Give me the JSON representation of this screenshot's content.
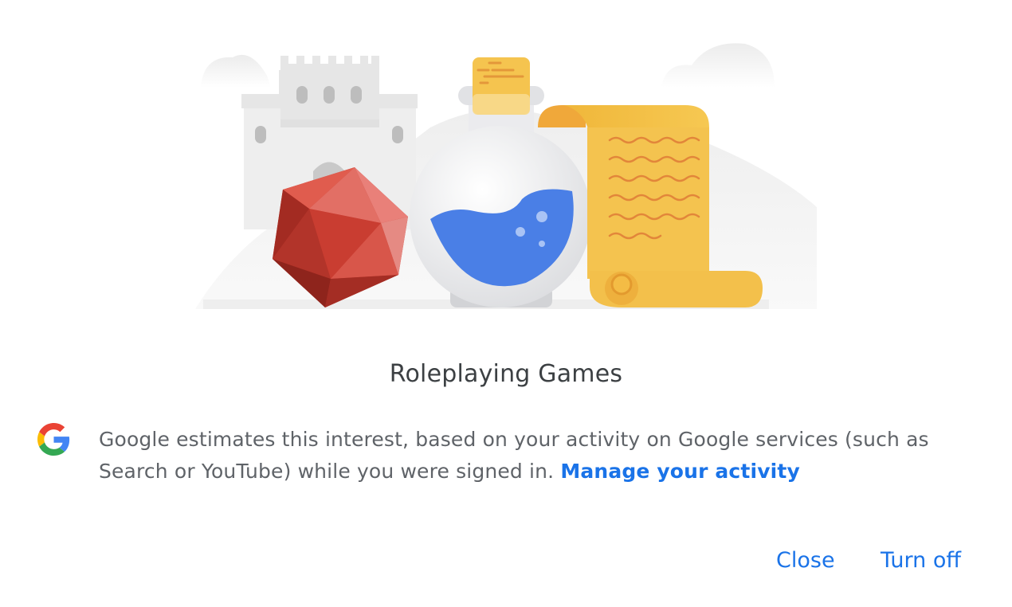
{
  "dialog": {
    "title": "Roleplaying Games",
    "description": "Google estimates this interest, based on your activity on Google services (such as Search or YouTube) while you were signed in.",
    "manage_link": "Manage your activity",
    "close_label": "Close",
    "turn_off_label": "Turn off"
  },
  "illustration": {
    "items": [
      "castle",
      "d20-dice",
      "potion-flask",
      "scroll"
    ]
  },
  "colors": {
    "accent": "#1a73e8",
    "title_text": "#3c4043",
    "body_text": "#5f6368",
    "dice_red": "#d94a3d",
    "potion_blue": "#4a7fe6",
    "scroll_yellow": "#f3c451"
  },
  "icons": {
    "brand": "google-g-logo"
  }
}
